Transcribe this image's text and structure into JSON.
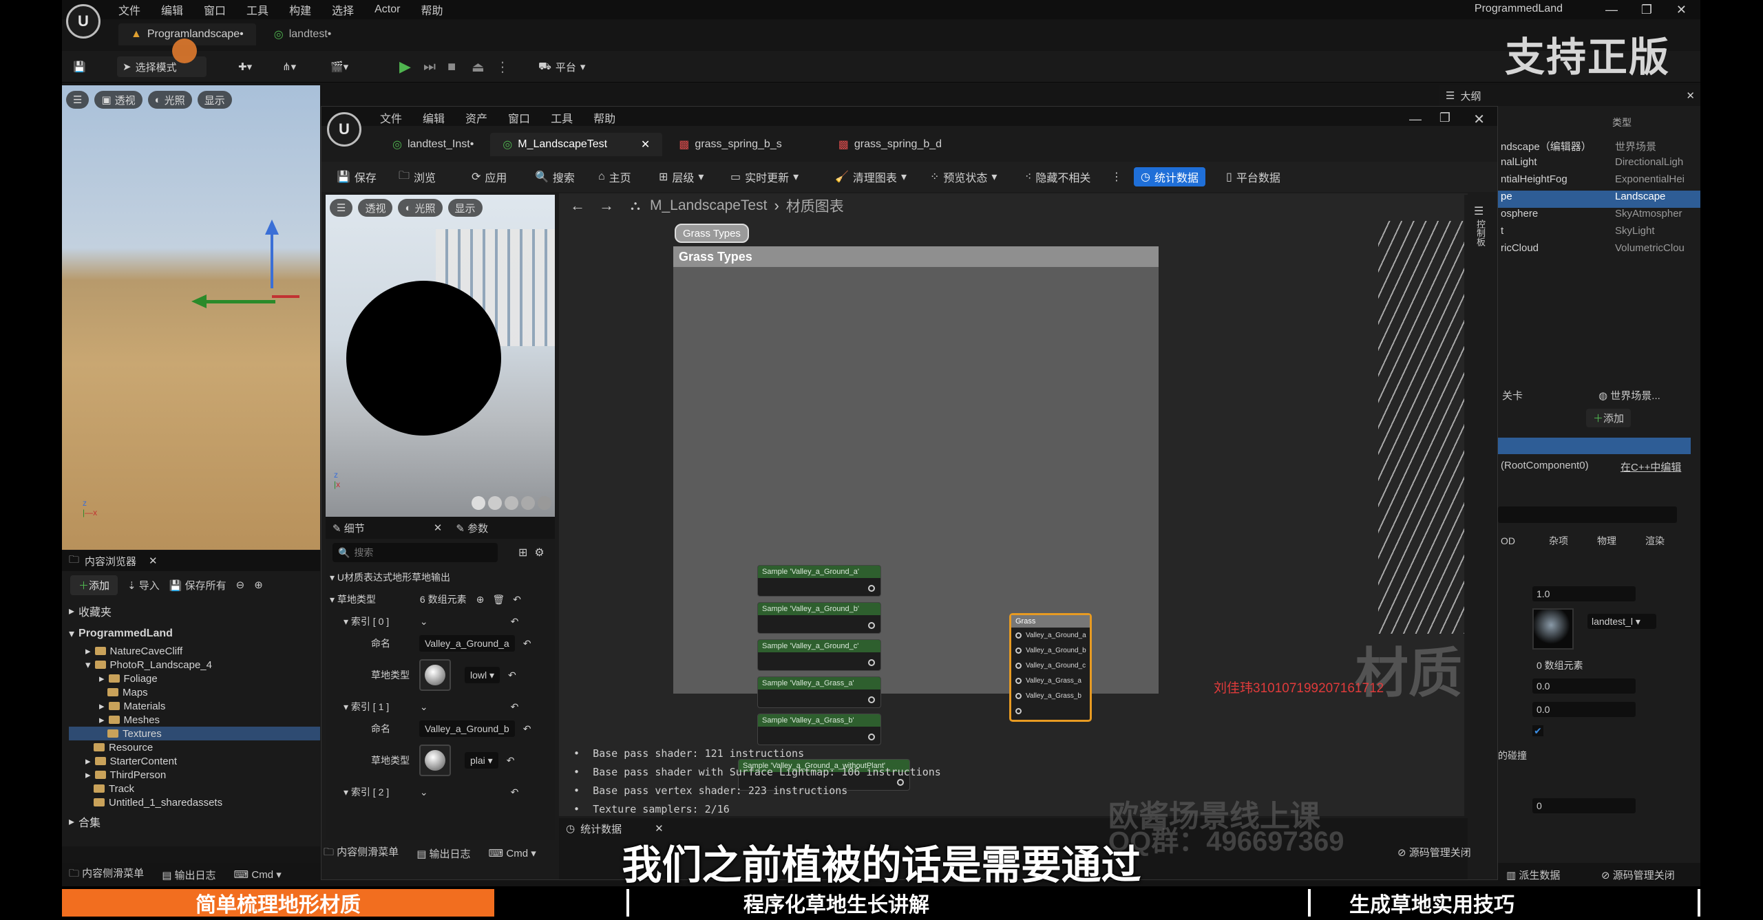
{
  "main": {
    "menu": [
      "文件",
      "编辑",
      "窗口",
      "工具",
      "构建",
      "选择",
      "Actor",
      "帮助"
    ],
    "project_title": "ProgrammedLand",
    "tabs": [
      {
        "label": "Programlandscape•"
      },
      {
        "label": "landtest•"
      }
    ],
    "toolbar": {
      "select_mode": "选择模式",
      "platform": "平台"
    },
    "viewport_chips": [
      "透视",
      "光照",
      "显示"
    ]
  },
  "content_browser": {
    "title": "内容浏览器",
    "add": "添加",
    "import": "导入",
    "save_all": "保存所有",
    "favorites": "收藏夹",
    "root": "ProgrammedLand",
    "items": [
      {
        "label": "NatureCaveCliff"
      },
      {
        "label": "PhotoR_Landscape_4"
      },
      {
        "label": "Foliage"
      },
      {
        "label": "Maps"
      },
      {
        "label": "Materials"
      },
      {
        "label": "Meshes"
      },
      {
        "label": "Textures"
      },
      {
        "label": "Resource"
      },
      {
        "label": "StarterContent"
      },
      {
        "label": "ThirdPerson"
      },
      {
        "label": "Track"
      },
      {
        "label": "Untitled_1_sharedassets"
      }
    ],
    "collections": "合集"
  },
  "status_bar": {
    "drawer": "内容侧滑菜单",
    "output_log": "输出日志",
    "cmd": "Cmd",
    "derived_data": "派生数据",
    "source_control": "源码管理关闭"
  },
  "outliner": {
    "title": "大纲",
    "type_header": "类型",
    "rows": [
      {
        "name": "ndscape（编辑器）",
        "type": "世界场景"
      },
      {
        "name": "nalLight",
        "type": "DirectionalLigh"
      },
      {
        "name": "ntialHeightFog",
        "type": "ExponentialHei"
      },
      {
        "name": "pe",
        "type": "Landscape"
      },
      {
        "name": "osphere",
        "type": "SkyAtmospher"
      },
      {
        "name": "t",
        "type": "SkyLight"
      },
      {
        "name": "ricCloud",
        "type": "VolumetricClou"
      }
    ],
    "details": {
      "level_label": "关卡",
      "world": "世界场景...",
      "add": "添加",
      "root_component": "(RootComponent0)",
      "edit_cpp": "在C++中编辑",
      "tabs": [
        "OD",
        "杂项",
        "物理",
        "渲染"
      ],
      "val_1": "1.0",
      "texture": "landtest_l",
      "array_count": "0 数组元素",
      "val_2": "0.0",
      "val_3": "0.0",
      "collision": "的碰撞",
      "val_4": "0"
    }
  },
  "material_editor": {
    "menu": [
      "文件",
      "编辑",
      "资产",
      "窗口",
      "工具",
      "帮助"
    ],
    "tabs": [
      {
        "label": "landtest_Inst•"
      },
      {
        "label": "M_LandscapeTest"
      },
      {
        "label": "grass_spring_b_s"
      },
      {
        "label": "grass_spring_b_d"
      }
    ],
    "toolbar": {
      "save": "保存",
      "browse": "浏览",
      "apply": "应用",
      "search": "搜索",
      "home": "主页",
      "hierarchy": "层级",
      "live_update": "实时更新",
      "clean_graph": "清理图表",
      "preview_state": "预览状态",
      "hide_unrelated": "隐藏不相关",
      "stats": "统计数据",
      "platform_stats": "平台数据"
    },
    "preview_chips": [
      "透视",
      "光照",
      "显示"
    ],
    "details": {
      "tab_details": "细节",
      "tab_params": "参数",
      "search_placeholder": "搜索",
      "section": "U材质表达式地形草地输出",
      "grass_types_label": "草地类型",
      "grass_types_count": "6 数组元素",
      "index0": "索引 [ 0 ]",
      "index1": "索引 [ 1 ]",
      "index2": "索引 [ 2 ]",
      "name_label": "命名",
      "name0": "Valley_a_Ground_a",
      "name1": "Valley_a_Ground_b",
      "grass_type_label": "草地类型",
      "type0": "lowl",
      "type1": "plai"
    },
    "breadcrumb": {
      "asset": "M_LandscapeTest",
      "graph": "材质图表",
      "side": "控制板"
    },
    "comment_bubble": "Grass Types",
    "comment_title": "Grass Types",
    "nodes": [
      {
        "label": "Sample 'Valley_a_Ground_a'"
      },
      {
        "label": "Sample 'Valley_a_Ground_b'"
      },
      {
        "label": "Sample 'Valley_a_Ground_c'"
      },
      {
        "label": "Sample 'Valley_a_Grass_a'"
      },
      {
        "label": "Sample 'Valley_a_Grass_b'"
      },
      {
        "label": "Sample 'Valley_a_Ground_a_withoutPlant'"
      }
    ],
    "grass_output": {
      "title": "Grass",
      "pins": [
        "Valley_a_Ground_a",
        "Valley_a_Ground_b",
        "Valley_a_Ground_c",
        "Valley_a_Grass_a",
        "Valley_a_Grass_b"
      ]
    },
    "stats": {
      "title": "统计数据",
      "lines": [
        "Base pass shader: 121 instructions",
        "Base pass shader with Surface Lightmap: 106 instructions",
        "Base pass vertex shader: 223 instructions",
        "Texture samplers: 2/16"
      ]
    },
    "status": {
      "drawer": "内容侧滑菜单",
      "output_log": "输出日志",
      "cmd": "Cmd",
      "source_control": "源码管理关闭"
    }
  },
  "overlay": {
    "logo_text": "支持正版",
    "material_watermark": "材质",
    "red_id": "刘佳玮310107199207161712",
    "promo_1": "欧酱场景线上课",
    "promo_2": "QQ群：496697369",
    "subtitle": "我们之前植被的话是需要通过",
    "chapters": [
      "简单梳理地形材质",
      "程序化草地生长讲解",
      "生成草地实用技巧"
    ],
    "accent": "#f26e1f"
  }
}
